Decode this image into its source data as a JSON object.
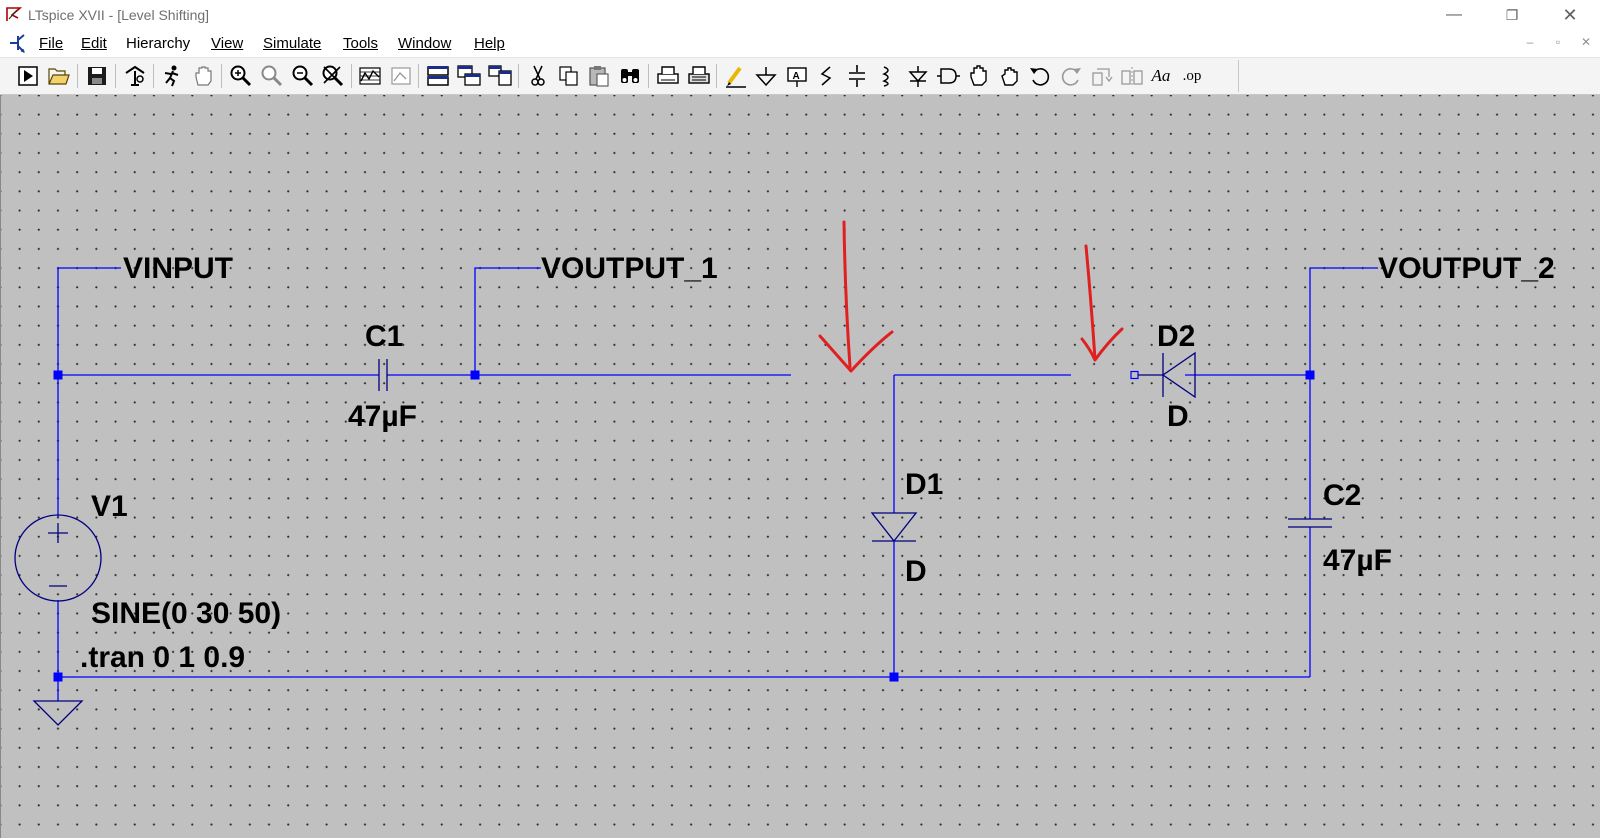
{
  "window": {
    "title": "LTspice XVII - [Level Shifting]",
    "controls": {
      "minimize": "—",
      "restore": "❐",
      "close": "✕"
    }
  },
  "menu": {
    "items": [
      {
        "key": "file",
        "label": "File"
      },
      {
        "key": "edit",
        "label": "Edit"
      },
      {
        "key": "hierarchy",
        "label": "Hierarchy"
      },
      {
        "key": "view",
        "label": "View"
      },
      {
        "key": "simulate",
        "label": "Simulate"
      },
      {
        "key": "tools",
        "label": "Tools"
      },
      {
        "key": "window",
        "label": "Window"
      },
      {
        "key": "help",
        "label": "Help"
      }
    ],
    "mdi": {
      "minimize": "–",
      "restore": "▫",
      "close": "✕"
    }
  },
  "toolbar": {
    "op_label": ".op",
    "text_label": "Aa",
    "buttons": [
      "run-icon",
      "open-icon",
      "save-icon",
      "control-panel-icon",
      "halt-icon",
      "pan-icon",
      "zoom-in-icon",
      "zoom-fit-icon",
      "zoom-out-icon",
      "zoom-cancel-icon",
      "waveform-icon",
      "autorange-icon",
      "tile-horizontal-icon",
      "cascade-icon",
      "tile-vertical-icon",
      "cut-icon",
      "copy-icon",
      "paste-icon",
      "find-icon",
      "print-icon",
      "print-setup-icon",
      "wire-icon",
      "ground-icon",
      "label-net-icon",
      "resistor-icon",
      "capacitor-icon",
      "inductor-icon",
      "diode-icon",
      "component-icon",
      "move-icon",
      "drag-icon",
      "undo-icon",
      "redo-icon",
      "rotate-icon",
      "mirror-icon",
      "text-icon",
      "spice-directive-icon"
    ]
  },
  "schematic": {
    "net_labels": {
      "vinput": "VINPUT",
      "voutput1": "VOUTPUT_1",
      "voutput2": "VOUTPUT_2"
    },
    "components": {
      "c1": {
        "name": "C1",
        "value": "47µF"
      },
      "c2": {
        "name": "C2",
        "value": "47µF"
      },
      "d1": {
        "name": "D1",
        "model": "D"
      },
      "d2": {
        "name": "D2",
        "model": "D"
      },
      "v1": {
        "name": "V1",
        "value": "SINE(0 30 50)"
      }
    },
    "directive": ".tran 0 1 0.9",
    "colors": {
      "wire": "#0000ff",
      "component": "#000080",
      "annotation": "#e02020",
      "canvas": "#c0c0c0"
    }
  }
}
